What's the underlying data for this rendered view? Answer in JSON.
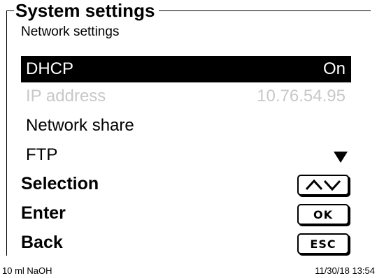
{
  "screen": {
    "title": "System settings",
    "subtitle": "Network settings"
  },
  "menu": [
    {
      "label": "DHCP",
      "value": "On",
      "state": "selected"
    },
    {
      "label": "IP address",
      "value": "10.76.54.95",
      "state": "disabled"
    },
    {
      "label": "Network share",
      "value": "",
      "state": "normal"
    },
    {
      "label": "FTP",
      "value": "",
      "state": "normal",
      "more_below": true
    }
  ],
  "softkeys": {
    "selection": {
      "label": "Selection",
      "button_icon": "up-down-arrows-icon"
    },
    "enter": {
      "label": "Enter",
      "button": "OK"
    },
    "back": {
      "label": "Back",
      "button": "ESC"
    }
  },
  "status_bar": {
    "left": "10 ml NaOH",
    "right": "11/30/18 13:54"
  },
  "colors": {
    "background": "#ffffff",
    "foreground": "#000000",
    "disabled_text": "#c8c8c8",
    "selected_bg": "#000000",
    "selected_text": "#ffffff"
  }
}
